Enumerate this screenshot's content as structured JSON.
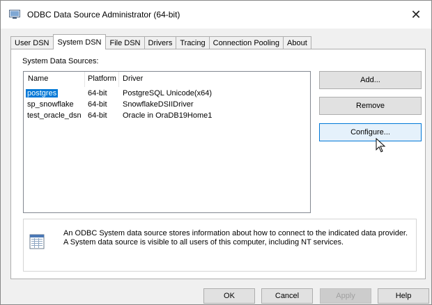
{
  "window": {
    "title": "ODBC Data Source Administrator (64-bit)",
    "close_glyph": "✕"
  },
  "tabs": [
    {
      "label": "User DSN",
      "active": false
    },
    {
      "label": "System DSN",
      "active": true
    },
    {
      "label": "File DSN",
      "active": false
    },
    {
      "label": "Drivers",
      "active": false
    },
    {
      "label": "Tracing",
      "active": false
    },
    {
      "label": "Connection Pooling",
      "active": false
    },
    {
      "label": "About",
      "active": false
    }
  ],
  "system_dsn": {
    "group_label": "System Data Sources:",
    "columns": [
      "Name",
      "Platform",
      "Driver"
    ],
    "rows": [
      {
        "name": "postgres",
        "platform": "64-bit",
        "driver": "PostgreSQL Unicode(x64)",
        "selected": true
      },
      {
        "name": "sp_snowflake",
        "platform": "64-bit",
        "driver": "SnowflakeDSIIDriver",
        "selected": false
      },
      {
        "name": "test_oracle_dsn",
        "platform": "64-bit",
        "driver": "Oracle in OraDB19Home1",
        "selected": false
      }
    ],
    "buttons": {
      "add": "Add...",
      "remove": "Remove",
      "configure": "Configure..."
    },
    "info_text_1": "An ODBC System data source stores information about how to connect to the indicated data provider.",
    "info_text_2": "A System data source is visible to all users of this computer, including NT services."
  },
  "footer": {
    "ok": "OK",
    "cancel": "Cancel",
    "apply": "Apply",
    "help": "Help"
  },
  "colors": {
    "selection": "#0078d7",
    "focus_border": "#0078d7"
  },
  "icons": [
    "odbc-app-icon",
    "close-icon",
    "data-source-info-icon",
    "mouse-cursor-icon"
  ]
}
